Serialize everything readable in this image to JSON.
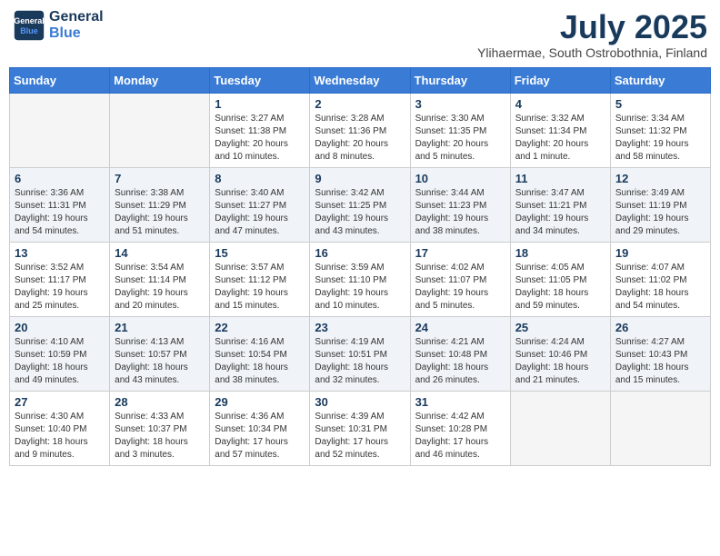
{
  "header": {
    "logo_line1": "General",
    "logo_line2": "Blue",
    "month": "July 2025",
    "location": "Ylihaermae, South Ostrobothnia, Finland"
  },
  "weekdays": [
    "Sunday",
    "Monday",
    "Tuesday",
    "Wednesday",
    "Thursday",
    "Friday",
    "Saturday"
  ],
  "weeks": [
    [
      {
        "num": "",
        "empty": true
      },
      {
        "num": "",
        "empty": true
      },
      {
        "num": "1",
        "sunrise": "Sunrise: 3:27 AM",
        "sunset": "Sunset: 11:38 PM",
        "daylight": "Daylight: 20 hours and 10 minutes."
      },
      {
        "num": "2",
        "sunrise": "Sunrise: 3:28 AM",
        "sunset": "Sunset: 11:36 PM",
        "daylight": "Daylight: 20 hours and 8 minutes."
      },
      {
        "num": "3",
        "sunrise": "Sunrise: 3:30 AM",
        "sunset": "Sunset: 11:35 PM",
        "daylight": "Daylight: 20 hours and 5 minutes."
      },
      {
        "num": "4",
        "sunrise": "Sunrise: 3:32 AM",
        "sunset": "Sunset: 11:34 PM",
        "daylight": "Daylight: 20 hours and 1 minute."
      },
      {
        "num": "5",
        "sunrise": "Sunrise: 3:34 AM",
        "sunset": "Sunset: 11:32 PM",
        "daylight": "Daylight: 19 hours and 58 minutes."
      }
    ],
    [
      {
        "num": "6",
        "sunrise": "Sunrise: 3:36 AM",
        "sunset": "Sunset: 11:31 PM",
        "daylight": "Daylight: 19 hours and 54 minutes."
      },
      {
        "num": "7",
        "sunrise": "Sunrise: 3:38 AM",
        "sunset": "Sunset: 11:29 PM",
        "daylight": "Daylight: 19 hours and 51 minutes."
      },
      {
        "num": "8",
        "sunrise": "Sunrise: 3:40 AM",
        "sunset": "Sunset: 11:27 PM",
        "daylight": "Daylight: 19 hours and 47 minutes."
      },
      {
        "num": "9",
        "sunrise": "Sunrise: 3:42 AM",
        "sunset": "Sunset: 11:25 PM",
        "daylight": "Daylight: 19 hours and 43 minutes."
      },
      {
        "num": "10",
        "sunrise": "Sunrise: 3:44 AM",
        "sunset": "Sunset: 11:23 PM",
        "daylight": "Daylight: 19 hours and 38 minutes."
      },
      {
        "num": "11",
        "sunrise": "Sunrise: 3:47 AM",
        "sunset": "Sunset: 11:21 PM",
        "daylight": "Daylight: 19 hours and 34 minutes."
      },
      {
        "num": "12",
        "sunrise": "Sunrise: 3:49 AM",
        "sunset": "Sunset: 11:19 PM",
        "daylight": "Daylight: 19 hours and 29 minutes."
      }
    ],
    [
      {
        "num": "13",
        "sunrise": "Sunrise: 3:52 AM",
        "sunset": "Sunset: 11:17 PM",
        "daylight": "Daylight: 19 hours and 25 minutes."
      },
      {
        "num": "14",
        "sunrise": "Sunrise: 3:54 AM",
        "sunset": "Sunset: 11:14 PM",
        "daylight": "Daylight: 19 hours and 20 minutes."
      },
      {
        "num": "15",
        "sunrise": "Sunrise: 3:57 AM",
        "sunset": "Sunset: 11:12 PM",
        "daylight": "Daylight: 19 hours and 15 minutes."
      },
      {
        "num": "16",
        "sunrise": "Sunrise: 3:59 AM",
        "sunset": "Sunset: 11:10 PM",
        "daylight": "Daylight: 19 hours and 10 minutes."
      },
      {
        "num": "17",
        "sunrise": "Sunrise: 4:02 AM",
        "sunset": "Sunset: 11:07 PM",
        "daylight": "Daylight: 19 hours and 5 minutes."
      },
      {
        "num": "18",
        "sunrise": "Sunrise: 4:05 AM",
        "sunset": "Sunset: 11:05 PM",
        "daylight": "Daylight: 18 hours and 59 minutes."
      },
      {
        "num": "19",
        "sunrise": "Sunrise: 4:07 AM",
        "sunset": "Sunset: 11:02 PM",
        "daylight": "Daylight: 18 hours and 54 minutes."
      }
    ],
    [
      {
        "num": "20",
        "sunrise": "Sunrise: 4:10 AM",
        "sunset": "Sunset: 10:59 PM",
        "daylight": "Daylight: 18 hours and 49 minutes."
      },
      {
        "num": "21",
        "sunrise": "Sunrise: 4:13 AM",
        "sunset": "Sunset: 10:57 PM",
        "daylight": "Daylight: 18 hours and 43 minutes."
      },
      {
        "num": "22",
        "sunrise": "Sunrise: 4:16 AM",
        "sunset": "Sunset: 10:54 PM",
        "daylight": "Daylight: 18 hours and 38 minutes."
      },
      {
        "num": "23",
        "sunrise": "Sunrise: 4:19 AM",
        "sunset": "Sunset: 10:51 PM",
        "daylight": "Daylight: 18 hours and 32 minutes."
      },
      {
        "num": "24",
        "sunrise": "Sunrise: 4:21 AM",
        "sunset": "Sunset: 10:48 PM",
        "daylight": "Daylight: 18 hours and 26 minutes."
      },
      {
        "num": "25",
        "sunrise": "Sunrise: 4:24 AM",
        "sunset": "Sunset: 10:46 PM",
        "daylight": "Daylight: 18 hours and 21 minutes."
      },
      {
        "num": "26",
        "sunrise": "Sunrise: 4:27 AM",
        "sunset": "Sunset: 10:43 PM",
        "daylight": "Daylight: 18 hours and 15 minutes."
      }
    ],
    [
      {
        "num": "27",
        "sunrise": "Sunrise: 4:30 AM",
        "sunset": "Sunset: 10:40 PM",
        "daylight": "Daylight: 18 hours and 9 minutes."
      },
      {
        "num": "28",
        "sunrise": "Sunrise: 4:33 AM",
        "sunset": "Sunset: 10:37 PM",
        "daylight": "Daylight: 18 hours and 3 minutes."
      },
      {
        "num": "29",
        "sunrise": "Sunrise: 4:36 AM",
        "sunset": "Sunset: 10:34 PM",
        "daylight": "Daylight: 17 hours and 57 minutes."
      },
      {
        "num": "30",
        "sunrise": "Sunrise: 4:39 AM",
        "sunset": "Sunset: 10:31 PM",
        "daylight": "Daylight: 17 hours and 52 minutes."
      },
      {
        "num": "31",
        "sunrise": "Sunrise: 4:42 AM",
        "sunset": "Sunset: 10:28 PM",
        "daylight": "Daylight: 17 hours and 46 minutes."
      },
      {
        "num": "",
        "empty": true
      },
      {
        "num": "",
        "empty": true
      }
    ]
  ]
}
